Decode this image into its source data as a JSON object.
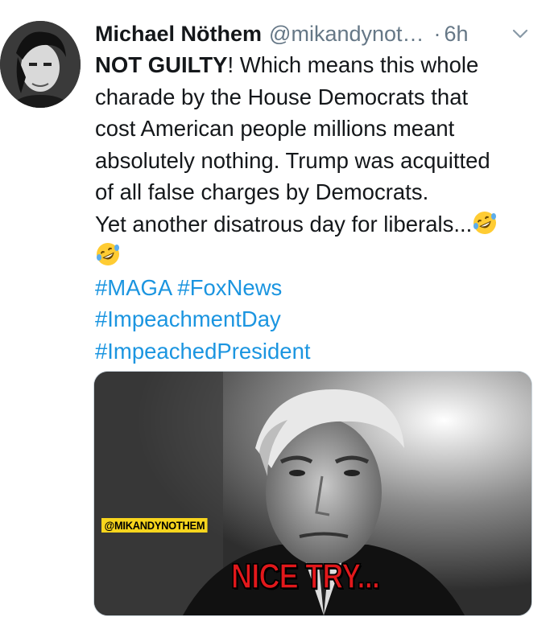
{
  "tweet": {
    "author_name": "Michael Nöthem",
    "author_handle": "@mikandynot…",
    "separator": "·",
    "time": "6h",
    "text_bold": "NOT GUILTY",
    "line1_rest": "! Which means this whole",
    "line2": "charade by the House Democrats that",
    "line3": "cost American people millions meant",
    "line4": "absolutely nothing. Trump was acquitted",
    "line5": "of all false charges by Democrats.",
    "line6": "Yet another disatrous day for liberals...",
    "hashtags": [
      "#MAGA",
      "#FoxNews",
      "#ImpeachmentDay",
      "#ImpeachedPresident"
    ],
    "emoji": "rolling-on-floor-laughing"
  },
  "media": {
    "watermark": "@MIKANDYNOTHEM",
    "caption": "NICE TRY..."
  },
  "colors": {
    "hashtag": "#1b95e0",
    "secondary_text": "#657786",
    "caption_red": "#e2181b",
    "watermark_bg": "#f7d51d"
  }
}
